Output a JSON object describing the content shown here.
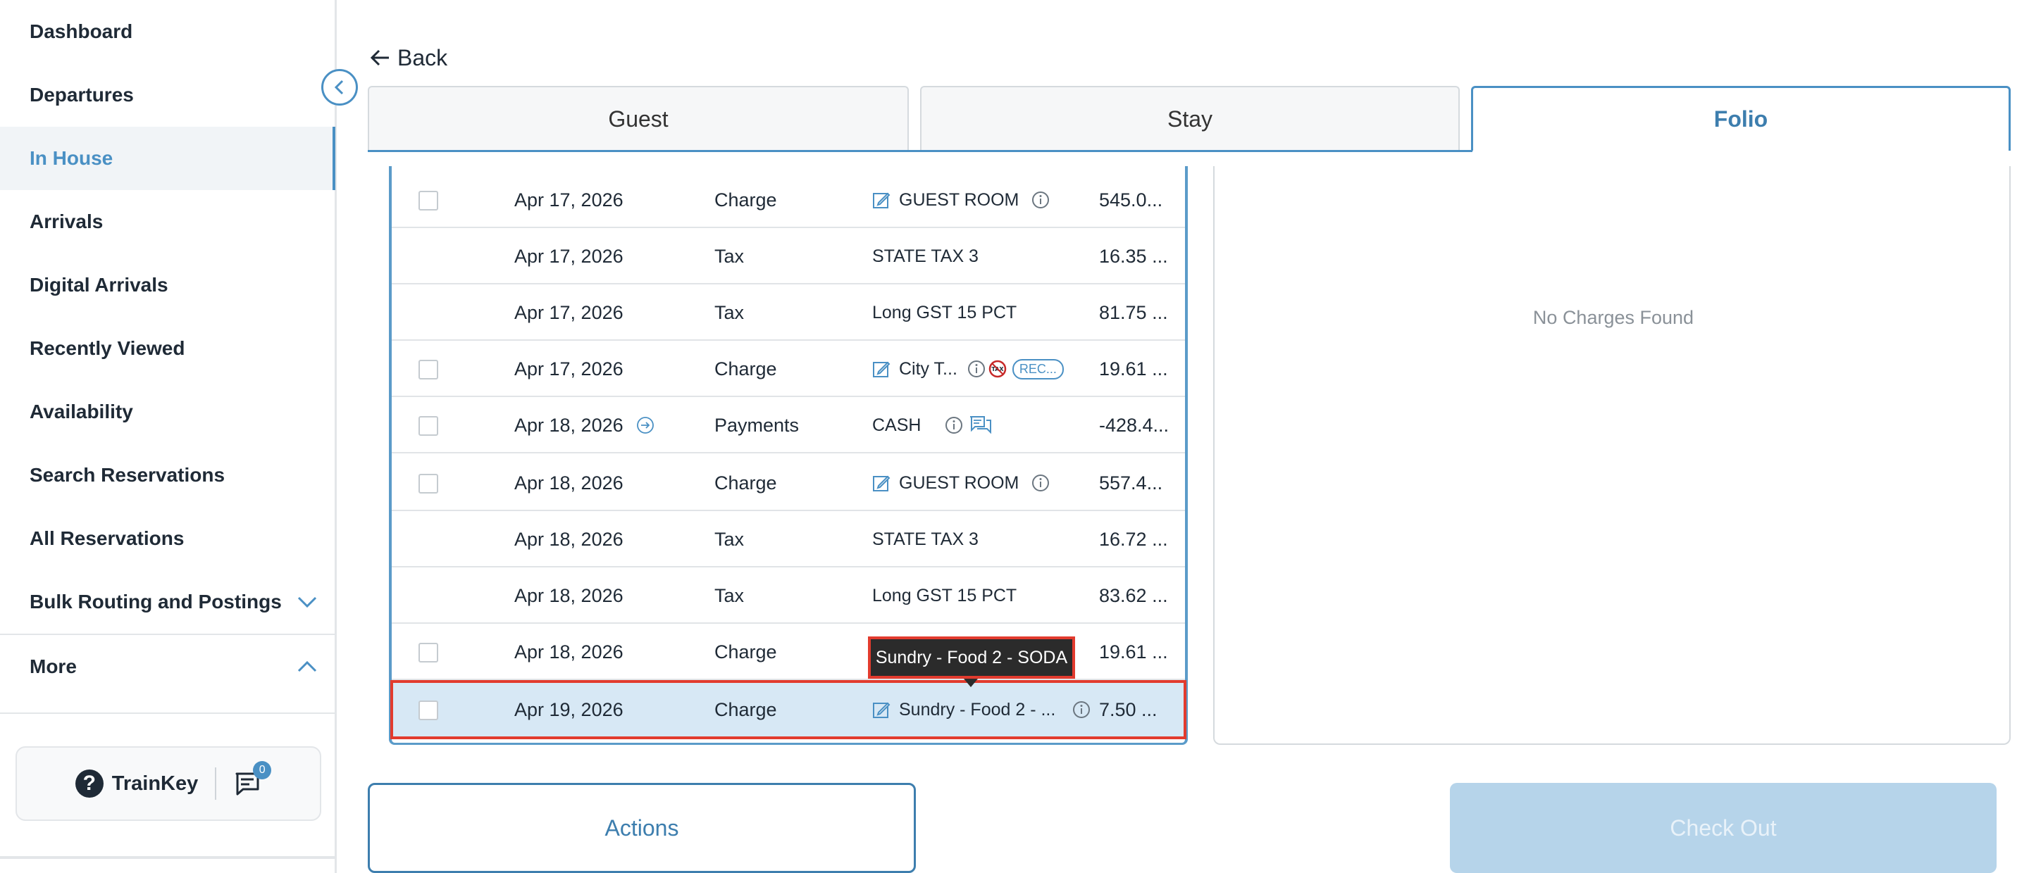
{
  "sidebar": {
    "items": [
      {
        "label": "Dashboard"
      },
      {
        "label": "Departures"
      },
      {
        "label": "In House"
      },
      {
        "label": "Arrivals"
      },
      {
        "label": "Digital Arrivals"
      },
      {
        "label": "Recently Viewed"
      },
      {
        "label": "Availability"
      },
      {
        "label": "Search Reservations"
      },
      {
        "label": "All Reservations"
      },
      {
        "label": "Bulk Routing and Postings"
      },
      {
        "label": "More"
      }
    ],
    "active_item": "In House",
    "trainkey_label": "TrainKey",
    "message_count": "0"
  },
  "header": {
    "back_label": "Back",
    "tabs": [
      {
        "label": "Guest"
      },
      {
        "label": "Stay"
      },
      {
        "label": "Folio"
      }
    ],
    "active_tab": "Folio"
  },
  "folio": {
    "rows": [
      {
        "date": "Apr 17, 2026",
        "type": "Charge",
        "desc": "GUEST ROOM",
        "amount": "545.0...",
        "checkbox": true,
        "edit": true,
        "info": true
      },
      {
        "date": "Apr 17, 2026",
        "type": "Tax",
        "desc": "STATE TAX 3",
        "amount": "16.35 ...",
        "checkbox": false
      },
      {
        "date": "Apr 17, 2026",
        "type": "Tax",
        "desc": "Long GST 15 PCT",
        "amount": "81.75 ...",
        "checkbox": false
      },
      {
        "date": "Apr 17, 2026",
        "type": "Charge",
        "desc": "City T...",
        "amount": "19.61 ...",
        "checkbox": true,
        "edit": true,
        "info": true,
        "tax_exempt": "TAX",
        "badge": "REC..."
      },
      {
        "date": "Apr 18, 2026",
        "type": "Payments",
        "desc": "CASH",
        "amount": "-428.4...",
        "checkbox": true,
        "info": true,
        "comment": true,
        "transfer": true
      },
      {
        "date": "Apr 18, 2026",
        "type": "Charge",
        "desc": "GUEST ROOM",
        "amount": "557.4...",
        "checkbox": true,
        "edit": true,
        "info": true
      },
      {
        "date": "Apr 18, 2026",
        "type": "Tax",
        "desc": "STATE TAX 3",
        "amount": "16.72 ...",
        "checkbox": false
      },
      {
        "date": "Apr 18, 2026",
        "type": "Tax",
        "desc": "Long GST 15 PCT",
        "amount": "83.62 ...",
        "checkbox": false
      },
      {
        "date": "Apr 18, 2026",
        "type": "Charge",
        "desc": "",
        "amount": "19.61 ...",
        "checkbox": true
      },
      {
        "date": "Apr 19, 2026",
        "type": "Charge",
        "desc": "Sundry - Food 2 - ...",
        "amount": "7.50 ...",
        "checkbox": true,
        "edit": true,
        "info": true,
        "selected": true
      }
    ],
    "tooltip": "Sundry - Food 2 - SODA"
  },
  "charges": {
    "empty_text": "No Charges Found"
  },
  "buttons": {
    "actions": "Actions",
    "checkout": "Check Out"
  },
  "colors": {
    "accent": "#4a90c4",
    "highlight": "#e23b2e",
    "selected_row": "#d7e8f5"
  }
}
